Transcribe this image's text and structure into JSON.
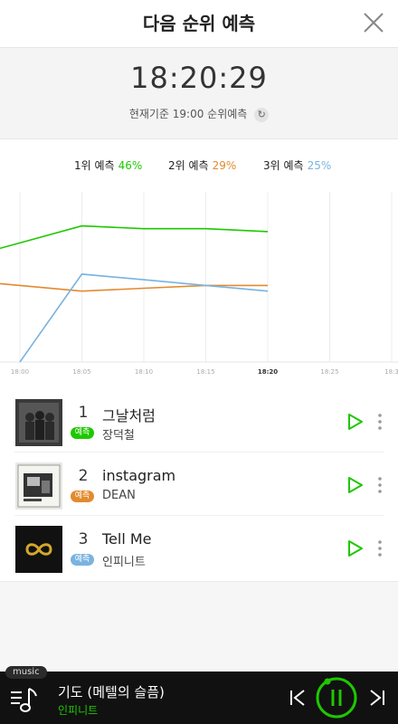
{
  "header": {
    "title": "다음 순위 예측"
  },
  "clock": {
    "time": "18:20:29",
    "basis": "현재기준 19:00 순위예측"
  },
  "legend": [
    {
      "label": "1위 예측",
      "pct": "46%",
      "color": "#1ec800"
    },
    {
      "label": "2위 예측",
      "pct": "29%",
      "color": "#e38a2e"
    },
    {
      "label": "3위 예측",
      "pct": "25%",
      "color": "#79b3e0"
    }
  ],
  "chart_data": {
    "type": "line",
    "x": [
      "18:00",
      "18:05",
      "18:10",
      "18:15",
      "18:20"
    ],
    "x_ticks": [
      "18:00",
      "18:05",
      "18:10",
      "18:15",
      "18:20",
      "18:25",
      "18:3"
    ],
    "ylim": [
      0,
      60
    ],
    "grid": true,
    "series": [
      {
        "name": "1위 예측",
        "color": "#1ec800",
        "values": [
          42,
          48,
          47,
          47,
          46
        ]
      },
      {
        "name": "2위 예측",
        "color": "#e38a2e",
        "values": [
          27,
          25,
          26,
          27,
          27
        ]
      },
      {
        "name": "3위 예측",
        "color": "#79b3e0",
        "values": [
          0,
          31,
          29,
          27,
          25
        ]
      }
    ]
  },
  "songs": [
    {
      "rank": "1",
      "title": "그날처럼",
      "artist": "장덕철",
      "badge": "예측",
      "badge_color": "#1ec800"
    },
    {
      "rank": "2",
      "title": "instagram",
      "artist": "DEAN",
      "badge": "예측",
      "badge_color": "#e38a2e"
    },
    {
      "rank": "3",
      "title": "Tell Me",
      "artist": "인피니트",
      "badge": "예측",
      "badge_color": "#79b3e0"
    }
  ],
  "player": {
    "tag": "music",
    "title": "기도 (메텔의 슬픔)",
    "artist": "인피니트"
  },
  "colors": {
    "accent": "#1ec800"
  }
}
